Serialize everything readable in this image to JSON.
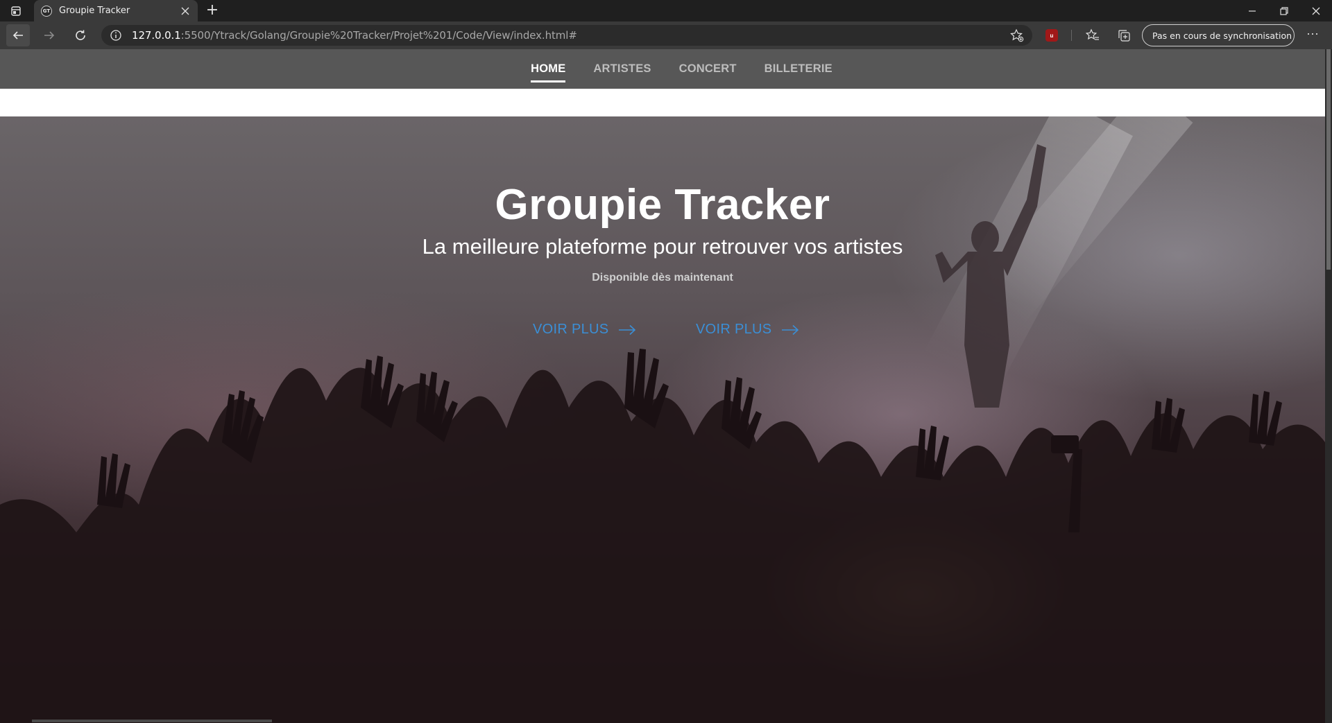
{
  "browser": {
    "tab": {
      "favicon_text": "GT",
      "title": "Groupie Tracker",
      "close_icon": "close-icon"
    },
    "new_tab_label": "+",
    "url_host": "127.0.0.1",
    "url_rest": ":5500/Ytrack/Golang/Groupie%20Tracker/Projet%201/Code/View/index.html#",
    "extension_badge": "u",
    "sync_label": "Pas en cours de synchronisation",
    "more_label": "···"
  },
  "nav": {
    "items": [
      {
        "label": "HOME",
        "active": true
      },
      {
        "label": "ARTISTES",
        "active": false
      },
      {
        "label": "CONCERT",
        "active": false
      },
      {
        "label": "BILLETERIE",
        "active": false
      }
    ]
  },
  "hero": {
    "title": "Groupie Tracker",
    "subtitle": "La meilleure plateforme pour retrouver vos artistes",
    "tagline": "Disponible dès maintenant",
    "cta_primary": "VOIR PLUS",
    "cta_secondary": "VOIR PLUS"
  },
  "colors": {
    "nav_background": "#575757",
    "cta": "#3b8fd6",
    "browser_chrome": "#3a3a3a"
  }
}
